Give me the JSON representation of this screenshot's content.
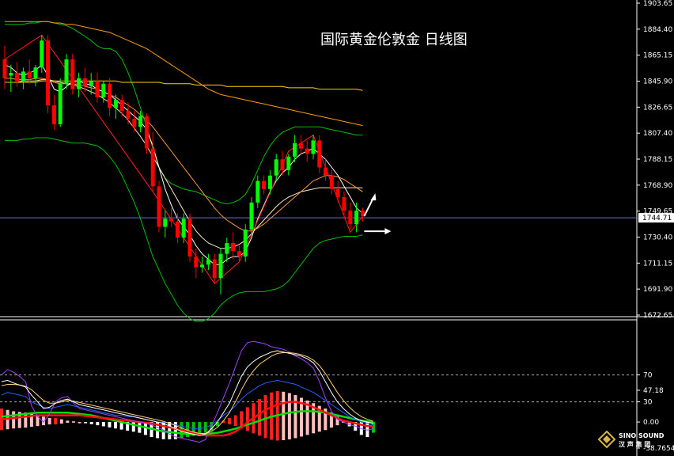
{
  "title": "国际黄金伦敦金 日线图",
  "logo": {
    "name": "SINO SOUND",
    "sub": "汉 声 集 团"
  },
  "current_price_label": "1744.71",
  "colors": {
    "bull": "#00ff00",
    "bear": "#ff0000",
    "ma_short": "#ffffff",
    "ma_mid": "#ffd000",
    "ma_long": "#ff9a00",
    "bollinger": "#00c000",
    "zigzag": "#ff2020",
    "price_line": "#8090ff"
  },
  "chart_data": [
    {
      "type": "candlestick",
      "title": "国际黄金伦敦金 日线图",
      "ylim": [
        1672.65,
        1903.65
      ],
      "y_ticks": [
        "1903.65",
        "1884.40",
        "1865.15",
        "1845.90",
        "1826.65",
        "1807.40",
        "1788.15",
        "1768.90",
        "1749.65",
        "1730.40",
        "1711.15",
        "1691.90",
        "1672.65"
      ],
      "current_price": 1744.71,
      "candles": [
        [
          1862,
          1872,
          1840,
          1848
        ],
        [
          1850,
          1858,
          1838,
          1852
        ],
        [
          1852,
          1860,
          1842,
          1846
        ],
        [
          1846,
          1856,
          1840,
          1853
        ],
        [
          1853,
          1862,
          1844,
          1848
        ],
        [
          1848,
          1858,
          1842,
          1856
        ],
        [
          1856,
          1880,
          1852,
          1876
        ],
        [
          1876,
          1880,
          1822,
          1828
        ],
        [
          1828,
          1836,
          1810,
          1814
        ],
        [
          1814,
          1848,
          1812,
          1844
        ],
        [
          1844,
          1866,
          1840,
          1862
        ],
        [
          1862,
          1866,
          1836,
          1840
        ],
        [
          1840,
          1852,
          1834,
          1848
        ],
        [
          1848,
          1856,
          1838,
          1842
        ],
        [
          1842,
          1852,
          1836,
          1846
        ],
        [
          1846,
          1852,
          1830,
          1834
        ],
        [
          1834,
          1846,
          1830,
          1844
        ],
        [
          1844,
          1848,
          1820,
          1826
        ],
        [
          1826,
          1836,
          1818,
          1832
        ],
        [
          1832,
          1836,
          1820,
          1824
        ],
        [
          1824,
          1830,
          1814,
          1818
        ],
        [
          1818,
          1824,
          1808,
          1812
        ],
        [
          1812,
          1824,
          1808,
          1820
        ],
        [
          1820,
          1822,
          1792,
          1796
        ],
        [
          1796,
          1808,
          1764,
          1768
        ],
        [
          1768,
          1772,
          1734,
          1738
        ],
        [
          1738,
          1750,
          1730,
          1744
        ],
        [
          1744,
          1752,
          1738,
          1742
        ],
        [
          1742,
          1748,
          1726,
          1730
        ],
        [
          1730,
          1748,
          1726,
          1744
        ],
        [
          1744,
          1748,
          1712,
          1716
        ],
        [
          1716,
          1722,
          1700,
          1708
        ],
        [
          1708,
          1716,
          1704,
          1710
        ],
        [
          1710,
          1718,
          1706,
          1714
        ],
        [
          1714,
          1718,
          1696,
          1700
        ],
        [
          1700,
          1722,
          1688,
          1718
        ],
        [
          1718,
          1730,
          1712,
          1726
        ],
        [
          1726,
          1734,
          1714,
          1720
        ],
        [
          1720,
          1724,
          1712,
          1716
        ],
        [
          1716,
          1740,
          1712,
          1736
        ],
        [
          1736,
          1760,
          1732,
          1756
        ],
        [
          1756,
          1776,
          1752,
          1772
        ],
        [
          1772,
          1776,
          1762,
          1766
        ],
        [
          1766,
          1780,
          1762,
          1776
        ],
        [
          1776,
          1792,
          1772,
          1788
        ],
        [
          1788,
          1794,
          1776,
          1780
        ],
        [
          1780,
          1792,
          1776,
          1790
        ],
        [
          1790,
          1806,
          1786,
          1800
        ],
        [
          1800,
          1806,
          1792,
          1796
        ],
        [
          1796,
          1802,
          1786,
          1792
        ],
        [
          1792,
          1806,
          1788,
          1802
        ],
        [
          1802,
          1806,
          1778,
          1782
        ],
        [
          1782,
          1788,
          1772,
          1776
        ],
        [
          1776,
          1780,
          1762,
          1766
        ],
        [
          1766,
          1772,
          1756,
          1760
        ],
        [
          1760,
          1764,
          1744,
          1750
        ],
        [
          1750,
          1756,
          1736,
          1740
        ],
        [
          1740,
          1756,
          1734,
          1750
        ],
        [
          1750,
          1752,
          1742,
          1746
        ]
      ],
      "ma_short": [
        1858,
        1856,
        1852,
        1850,
        1852,
        1854,
        1858,
        1850,
        1840,
        1838,
        1842,
        1846,
        1846,
        1844,
        1843,
        1840,
        1838,
        1836,
        1832,
        1828,
        1824,
        1820,
        1816,
        1810,
        1798,
        1782,
        1766,
        1754,
        1744,
        1738,
        1732,
        1724,
        1718,
        1714,
        1710,
        1710,
        1714,
        1716,
        1716,
        1720,
        1730,
        1744,
        1754,
        1764,
        1772,
        1778,
        1782,
        1788,
        1792,
        1794,
        1796,
        1792,
        1788,
        1782,
        1776,
        1768,
        1760,
        1752,
        1748
      ],
      "ma_mid": [
        1848,
        1848,
        1847,
        1847,
        1847,
        1848,
        1848,
        1847,
        1845,
        1844,
        1844,
        1844,
        1843,
        1842,
        1841,
        1840,
        1838,
        1836,
        1834,
        1831,
        1828,
        1825,
        1821,
        1817,
        1812,
        1806,
        1800,
        1794,
        1788,
        1782,
        1776,
        1770,
        1764,
        1758,
        1752,
        1747,
        1743,
        1740,
        1737,
        1735,
        1735,
        1737,
        1740,
        1744,
        1748,
        1752,
        1756,
        1760,
        1764,
        1768,
        1772,
        1774,
        1776,
        1776,
        1775,
        1773,
        1770,
        1767,
        1764
      ],
      "ma_long": [
        1890,
        1890,
        1890,
        1890,
        1890,
        1890,
        1890,
        1890,
        1889,
        1889,
        1888,
        1888,
        1887,
        1886,
        1885,
        1884,
        1883,
        1882,
        1880,
        1878,
        1876,
        1874,
        1872,
        1870,
        1867,
        1864,
        1861,
        1858,
        1855,
        1852,
        1849,
        1846,
        1843,
        1840,
        1838,
        1836,
        1835,
        1834,
        1833,
        1832,
        1831,
        1830,
        1829,
        1828,
        1827,
        1826,
        1825,
        1824,
        1823,
        1822,
        1821,
        1820,
        1819,
        1818,
        1817,
        1816,
        1815,
        1814,
        1813
      ],
      "ma_flat": [
        1845,
        1845,
        1845,
        1845,
        1845,
        1845,
        1846,
        1846,
        1846,
        1846,
        1846,
        1846,
        1846,
        1846,
        1846,
        1846,
        1846,
        1846,
        1846,
        1845,
        1845,
        1845,
        1845,
        1845,
        1845,
        1845,
        1844,
        1844,
        1844,
        1844,
        1844,
        1843,
        1843,
        1843,
        1843,
        1843,
        1842,
        1842,
        1842,
        1842,
        1842,
        1842,
        1842,
        1842,
        1842,
        1842,
        1841,
        1841,
        1841,
        1841,
        1841,
        1840,
        1840,
        1840,
        1840,
        1840,
        1840,
        1840,
        1839
      ],
      "boll_upper": [
        1888,
        1888,
        1888,
        1888,
        1889,
        1889,
        1890,
        1890,
        1889,
        1888,
        1887,
        1885,
        1882,
        1879,
        1876,
        1872,
        1870,
        1870,
        1868,
        1862,
        1852,
        1840,
        1826,
        1812,
        1796,
        1782,
        1774,
        1770,
        1768,
        1766,
        1765,
        1764,
        1762,
        1760,
        1758,
        1756,
        1755,
        1756,
        1758,
        1762,
        1770,
        1780,
        1790,
        1798,
        1804,
        1808,
        1810,
        1812,
        1812,
        1812,
        1812,
        1812,
        1811,
        1810,
        1809,
        1808,
        1807,
        1806,
        1806
      ],
      "boll_mid": [
        1845,
        1845,
        1845,
        1846,
        1846,
        1846,
        1847,
        1847,
        1846,
        1845,
        1844,
        1843,
        1842,
        1840,
        1838,
        1836,
        1833,
        1830,
        1826,
        1822,
        1817,
        1811,
        1805,
        1798,
        1790,
        1782,
        1774,
        1766,
        1758,
        1750,
        1742,
        1735,
        1730,
        1726,
        1724,
        1722,
        1722,
        1723,
        1725,
        1728,
        1733,
        1738,
        1743,
        1748,
        1753,
        1757,
        1760,
        1762,
        1764,
        1765,
        1766,
        1767,
        1767,
        1767,
        1767,
        1767,
        1767,
        1767,
        1767
      ],
      "boll_lower": [
        1802,
        1802,
        1802,
        1803,
        1803,
        1804,
        1804,
        1804,
        1803,
        1802,
        1801,
        1800,
        1800,
        1800,
        1799,
        1798,
        1795,
        1790,
        1784,
        1776,
        1766,
        1756,
        1744,
        1730,
        1716,
        1706,
        1696,
        1688,
        1680,
        1674,
        1670,
        1668,
        1668,
        1670,
        1674,
        1680,
        1684,
        1687,
        1689,
        1690,
        1690,
        1690,
        1690,
        1691,
        1692,
        1694,
        1698,
        1704,
        1710,
        1716,
        1722,
        1726,
        1728,
        1729,
        1730,
        1731,
        1731,
        1731,
        1732
      ],
      "zigzag": [
        [
          0,
          1862
        ],
        [
          6,
          1880
        ],
        [
          24,
          1764
        ],
        [
          34,
          1696
        ],
        [
          38,
          1712
        ],
        [
          46,
          1794
        ],
        [
          50,
          1806
        ],
        [
          56,
          1734
        ],
        [
          58,
          1746
        ]
      ]
    },
    {
      "type": "oscillator",
      "ylim": [
        -38.7654,
        147.18
      ],
      "y_ticks": [
        "47.18",
        "70",
        "0.00",
        "30",
        "-38.7654"
      ],
      "histogram": [
        20,
        18,
        16,
        15,
        14,
        12,
        10,
        8,
        6,
        6,
        4,
        2,
        1,
        0,
        -1,
        -2,
        -3,
        -4,
        -5,
        -6,
        -7,
        -8,
        -9,
        -10,
        -12,
        -14,
        -15,
        -16,
        -16,
        -16,
        -15,
        -14,
        -13,
        -12,
        -10,
        -8,
        -4,
        2,
        6,
        10,
        16,
        22,
        28,
        34,
        40,
        44,
        46,
        45,
        43,
        40,
        36,
        32,
        28,
        24,
        20,
        14,
        8,
        2,
        -4,
        -8,
        -12,
        -14,
        -10
      ],
      "k_line": [
        60,
        62,
        58,
        55,
        52,
        40,
        30,
        20,
        22,
        28,
        32,
        34,
        30,
        26,
        24,
        22,
        20,
        18,
        16,
        14,
        12,
        10,
        8,
        6,
        4,
        2,
        0,
        -2,
        -6,
        -10,
        -14,
        -16,
        -18,
        -20,
        -18,
        -10,
        0,
        14,
        28,
        48,
        68,
        82,
        90,
        96,
        100,
        104,
        106,
        104,
        102,
        100,
        98,
        94,
        88,
        76,
        60,
        44,
        30,
        20,
        12,
        6,
        2,
        0,
        -2
      ],
      "d_line": [
        54,
        56,
        56,
        55,
        53,
        48,
        40,
        32,
        28,
        28,
        30,
        32,
        31,
        29,
        27,
        25,
        23,
        21,
        19,
        17,
        15,
        13,
        11,
        9,
        7,
        5,
        3,
        1,
        -2,
        -5,
        -9,
        -12,
        -15,
        -17,
        -17,
        -14,
        -8,
        2,
        14,
        30,
        48,
        64,
        76,
        86,
        92,
        98,
        102,
        103,
        103,
        102,
        100,
        97,
        92,
        84,
        72,
        58,
        44,
        32,
        22,
        14,
        8,
        4,
        1
      ],
      "j_line": [
        70,
        78,
        74,
        68,
        60,
        24,
        8,
        0,
        12,
        30,
        36,
        38,
        28,
        20,
        18,
        16,
        14,
        12,
        10,
        8,
        6,
        4,
        2,
        0,
        -2,
        -4,
        -8,
        -12,
        -18,
        -22,
        -24,
        -26,
        -28,
        -30,
        -26,
        -6,
        14,
        36,
        58,
        82,
        106,
        118,
        120,
        118,
        116,
        112,
        110,
        108,
        104,
        98,
        94,
        88,
        80,
        60,
        36,
        16,
        4,
        0,
        -4,
        -6,
        -10,
        -12,
        -10
      ],
      "blue_line": [
        40,
        44,
        42,
        40,
        38,
        30,
        26,
        22,
        20,
        22,
        24,
        26,
        24,
        22,
        20,
        18,
        16,
        14,
        12,
        10,
        10,
        8,
        8,
        6,
        4,
        2,
        0,
        0,
        -2,
        -4,
        -6,
        -8,
        -10,
        -10,
        -8,
        -4,
        2,
        10,
        16,
        24,
        34,
        42,
        48,
        54,
        58,
        60,
        62,
        60,
        58,
        56,
        52,
        48,
        44,
        38,
        32,
        26,
        20,
        14,
        8,
        4,
        0,
        -2,
        -4
      ],
      "red_line": [
        4,
        5,
        6,
        7,
        8,
        9,
        10,
        10,
        10,
        10,
        10,
        10,
        10,
        10,
        9,
        8,
        7,
        6,
        5,
        4,
        3,
        2,
        1,
        0,
        -1,
        -2,
        -4,
        -6,
        -8,
        -10,
        -12,
        -14,
        -16,
        -18,
        -20,
        -20,
        -20,
        -20,
        -18,
        -14,
        -8,
        0,
        6,
        12,
        18,
        22,
        26,
        28,
        30,
        30,
        28,
        26,
        22,
        18,
        14,
        10,
        6,
        2,
        0,
        -2,
        -4,
        -6,
        -6
      ],
      "green_line": [
        8,
        9,
        10,
        11,
        12,
        13,
        14,
        14,
        14,
        14,
        14,
        14,
        13,
        12,
        11,
        10,
        8,
        6,
        4,
        2,
        0,
        -2,
        -4,
        -6,
        -8,
        -10,
        -12,
        -14,
        -15,
        -16,
        -17,
        -18,
        -18,
        -18,
        -18,
        -17,
        -16,
        -14,
        -12,
        -10,
        -7,
        -4,
        -1,
        2,
        5,
        8,
        10,
        12,
        14,
        15,
        16,
        16,
        16,
        15,
        14,
        12,
        10,
        8,
        6,
        4,
        2,
        1,
        0
      ]
    }
  ]
}
